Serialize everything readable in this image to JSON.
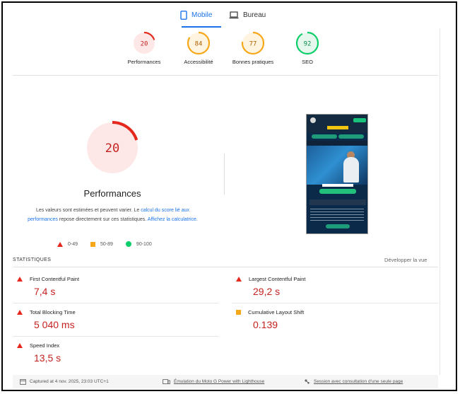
{
  "tabs": [
    {
      "label": "Mobile",
      "icon": "phone-icon",
      "active": true
    },
    {
      "label": "Bureau",
      "icon": "laptop-icon",
      "active": false
    }
  ],
  "gauges": [
    {
      "score": "20",
      "label": "Performances",
      "color": "#e5281e",
      "bg": "#fde8e7",
      "fraction": 0.2
    },
    {
      "score": "84",
      "label": "Accessibilité",
      "color": "#f6a81a",
      "bg": "#fff4e0",
      "fraction": 0.84
    },
    {
      "score": "77",
      "label": "Bonnes pratiques",
      "color": "#f6a81a",
      "bg": "#fff4e0",
      "fraction": 0.77
    },
    {
      "score": "92",
      "label": "SEO",
      "color": "#0cce6b",
      "bg": "#e6f8ee",
      "fraction": 0.92
    }
  ],
  "main": {
    "score": "20",
    "fraction": 0.2,
    "title": "Performances",
    "desc_1": "Les valeurs sont estimées et peuvent varier. Le ",
    "desc_link1": "calcul du score lié aux performances",
    "desc_2": " repose directement sur ces statistiques. ",
    "desc_link2": "Affichez la calculatrice."
  },
  "legend": [
    {
      "range": "0-49",
      "shape": "triangle",
      "color": "#e5281e"
    },
    {
      "range": "50-89",
      "shape": "square",
      "color": "#f6a81a"
    },
    {
      "range": "90-100",
      "shape": "circle",
      "color": "#0cce6b"
    }
  ],
  "stats": {
    "heading": "STATISTIQUES",
    "expand": "Développer la vue",
    "metrics": [
      {
        "name": "First Contentful Paint",
        "value": "7,4 s",
        "status": "red"
      },
      {
        "name": "Largest Contentful Paint",
        "value": "29,2 s",
        "status": "red"
      },
      {
        "name": "Total Blocking Time",
        "value": "5 040 ms",
        "status": "red"
      },
      {
        "name": "Cumulative Layout Shift",
        "value": "0.139",
        "status": "orange"
      },
      {
        "name": "Speed Index",
        "value": "13,5 s",
        "status": "red"
      }
    ]
  },
  "footer": {
    "captured": "Captured at 4 nov. 2025, 23:03 UTC+1",
    "emulation": "Émulation du Moto G Power with Lighthouse",
    "session": "Session avec consultation d'une seule page"
  }
}
